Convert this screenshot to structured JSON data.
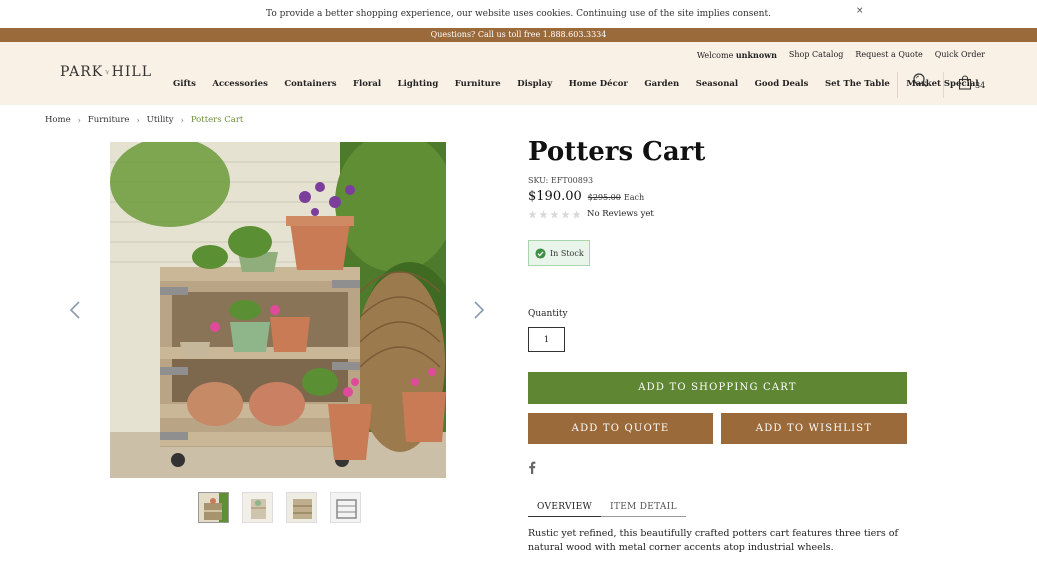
{
  "cookie_bar": {
    "message": "To provide a better shopping experience, our website uses cookies. Continuing use of the site implies consent.",
    "close_label": "×"
  },
  "promo_bar": {
    "text": "Questions? Call us toll free 1.888.603.3334"
  },
  "header": {
    "util_nav": {
      "welcome_prefix": "Welcome",
      "welcome_user": "unknown",
      "shop_catalog": "Shop Catalog",
      "request_quote": "Request a Quote",
      "quick_order": "Quick Order"
    },
    "logo_text_left": "PARK",
    "logo_text_right": "HILL",
    "nav_items": [
      "Gifts",
      "Accessories",
      "Containers",
      "Floral",
      "Lighting",
      "Furniture",
      "Display",
      "Home Décor",
      "Garden",
      "Seasonal",
      "Good Deals",
      "Set The Table",
      "Market Special"
    ],
    "cart_count": "34"
  },
  "breadcrumb": [
    "Home",
    "Furniture",
    "Utility",
    "Potters Cart"
  ],
  "product": {
    "title": "Potters Cart",
    "sku": "SKU: EFT00893",
    "price": "$190.00",
    "old_price": "$295.00",
    "price_unit": "Each",
    "reviews_text": "No Reviews yet",
    "rating": 0,
    "stock_text": "In Stock",
    "quantity_label": "Quantity",
    "quantity_value": "1",
    "add_to_cart": "ADD TO SHOPPING CART",
    "add_to_quote": "ADD TO QUOTE",
    "add_to_wishlist": "ADD TO WISHLIST"
  },
  "tabs": [
    "OVERVIEW",
    "ITEM DETAIL"
  ],
  "description": "Rustic yet refined, this beautifully crafted potters cart features three tiers of natural wood with metal corner accents atop industrial wheels.",
  "colors": {
    "brand_brown": "#9a6a3b",
    "cart_green": "#5f8632",
    "header_bg": "#f9f0e6",
    "breadcrumb_active": "#6d8f3a"
  }
}
